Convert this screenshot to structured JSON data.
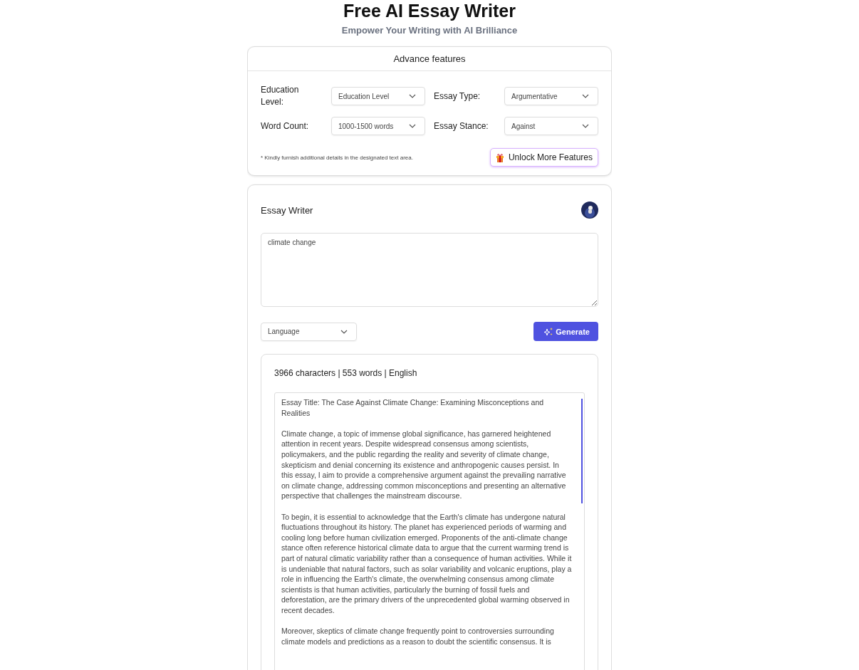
{
  "header": {
    "title": "Free AI Essay Writer",
    "subtitle": "Empower Your Writing with AI Brilliance"
  },
  "advanced": {
    "title": "Advance features",
    "fields": [
      {
        "label": "Education Level:",
        "value": "Education Level"
      },
      {
        "label": "Essay Type:",
        "value": "Argumentative"
      },
      {
        "label": "Word Count:",
        "value": "1000-1500 words"
      },
      {
        "label": "Essay Stance:",
        "value": "Against"
      }
    ],
    "note": "* Kindly furnish additional details in the designated text area.",
    "unlock_button": "Unlock More Features"
  },
  "writer": {
    "title": "Essay Writer",
    "input": "climate change",
    "language": {
      "placeholder": "Language"
    },
    "generate_button": "Generate"
  },
  "output": {
    "stats": "3966 characters | 553 words | English",
    "paragraphs": [
      " Essay Title: The Case Against Climate Change: Examining Misconceptions and Realities",
      "Climate change, a topic of immense global significance, has garnered heightened attention in recent years. Despite widespread consensus among scientists, policymakers, and the public regarding the reality and severity of climate change, skepticism and denial concerning its existence and anthropogenic causes persist. In this essay, I aim to provide a comprehensive argument against the prevailing narrative on climate change, addressing common misconceptions and presenting an alternative perspective that challenges the mainstream discourse.",
      "To begin, it is essential to acknowledge that the Earth's climate has undergone natural fluctuations throughout its history. The planet has experienced periods of warming and cooling long before human civilization emerged. Proponents of the anti-climate change stance often reference historical climate data to argue that the current warming trend is part of natural climatic variability rather than a consequence of human activities. While it is undeniable that natural factors, such as solar variability and volcanic eruptions, play a role in influencing the Earth's climate, the overwhelming consensus among climate scientists is that human activities, particularly the burning of fossil fuels and deforestation, are the primary drivers of the unprecedented global warming observed in recent decades.",
      "Moreover, skeptics of climate change frequently point to controversies surrounding climate models and predictions as a reason to doubt the scientific consensus. It is"
    ]
  }
}
